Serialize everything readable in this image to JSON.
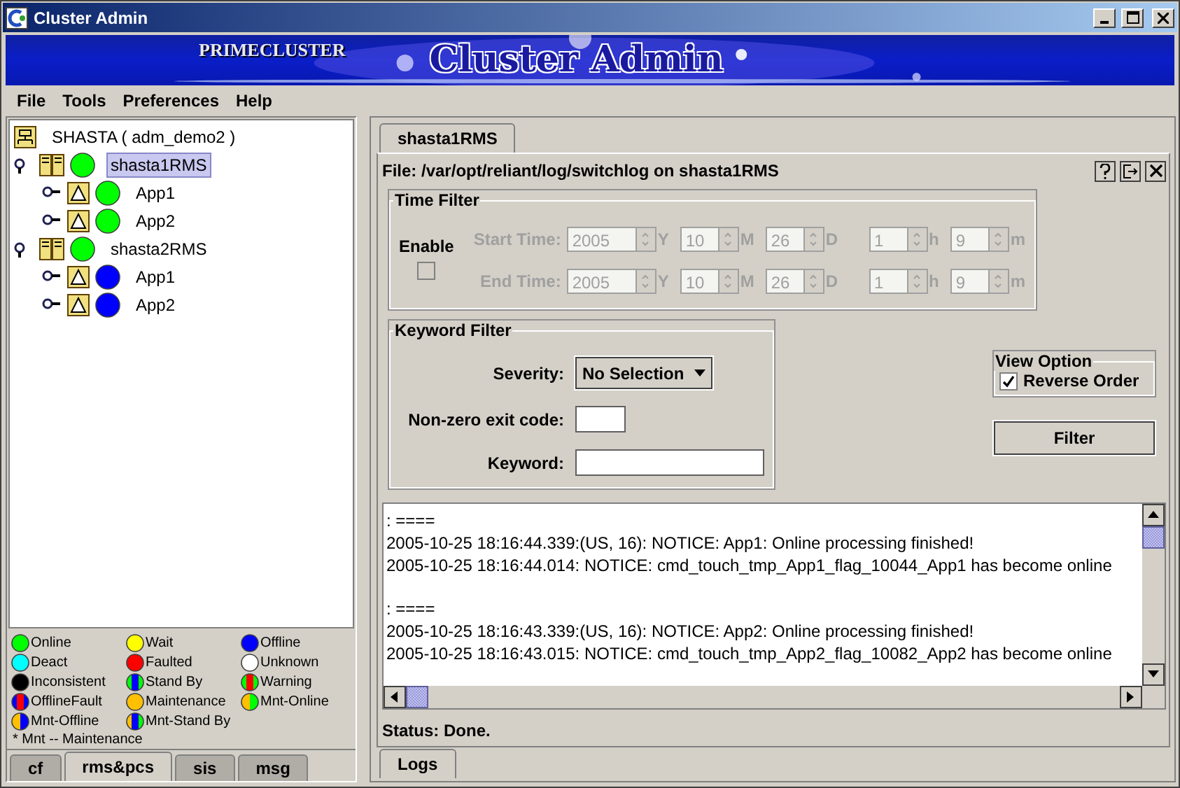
{
  "window": {
    "title": "Cluster Admin"
  },
  "banner": {
    "brand": "PRIMECLUSTER",
    "title": "Cluster Admin"
  },
  "menu": [
    "File",
    "Tools",
    "Preferences",
    "Help"
  ],
  "tree": {
    "label": "SHASTA ( adm_demo2 )",
    "kind": "cluster",
    "children": [
      {
        "label": "shasta1RMS",
        "kind": "node",
        "color": "#00ff00",
        "selected": true,
        "expanded": true,
        "children": [
          {
            "label": "App1",
            "kind": "app",
            "color": "#00ff00",
            "selected": false,
            "expanded": false
          },
          {
            "label": "App2",
            "kind": "app",
            "color": "#00ff00",
            "selected": false,
            "expanded": false
          }
        ]
      },
      {
        "label": "shasta2RMS",
        "kind": "node",
        "color": "#00ff00",
        "selected": false,
        "expanded": true,
        "children": [
          {
            "label": "App1",
            "kind": "app",
            "color": "#0000ff",
            "selected": false,
            "expanded": false
          },
          {
            "label": "App2",
            "kind": "app",
            "color": "#0000ff",
            "selected": false,
            "expanded": false
          }
        ]
      }
    ]
  },
  "legend": [
    {
      "label": "Online",
      "segments": [
        {
          "color": "#00ff00"
        }
      ]
    },
    {
      "label": "Wait",
      "segments": [
        {
          "color": "#ffff00"
        }
      ]
    },
    {
      "label": "Offline",
      "segments": [
        {
          "color": "#0000ff"
        }
      ]
    },
    {
      "label": "Deact",
      "segments": [
        {
          "color": "#00ffff"
        }
      ]
    },
    {
      "label": "Faulted",
      "segments": [
        {
          "color": "#ff0000"
        }
      ]
    },
    {
      "label": "Unknown",
      "segments": [
        {
          "color": "#ffffff"
        }
      ]
    },
    {
      "label": "Inconsistent",
      "segments": [
        {
          "color": "#000000"
        }
      ]
    },
    {
      "label": "Stand By",
      "segments": [
        {
          "color": "#00ff00"
        },
        {
          "color": "#0000ff"
        },
        {
          "color": "#00ff00"
        }
      ]
    },
    {
      "label": "Warning",
      "segments": [
        {
          "color": "#00ff00"
        },
        {
          "color": "#ff0000"
        },
        {
          "color": "#00ff00"
        }
      ]
    },
    {
      "label": "OfflineFault",
      "segments": [
        {
          "color": "#0000ff"
        },
        {
          "color": "#ff0000"
        },
        {
          "color": "#0000ff"
        }
      ]
    },
    {
      "label": "Maintenance",
      "segments": [
        {
          "color": "#ffc000"
        }
      ]
    },
    {
      "label": "Mnt-Online",
      "segments": [
        {
          "color": "#ffc000"
        },
        {
          "color": "#00ff00"
        }
      ]
    },
    {
      "label": "Mnt-Offline",
      "segments": [
        {
          "color": "#ffc000"
        },
        {
          "color": "#0000ff"
        }
      ]
    },
    {
      "label": "Mnt-Stand By",
      "segments": [
        {
          "color": "#ffc000"
        },
        {
          "color": "#0000ff"
        },
        {
          "color": "#00ff00"
        }
      ]
    }
  ],
  "legend_note": "* Mnt -- Maintenance",
  "left_tabs": [
    {
      "label": "cf",
      "selected": false
    },
    {
      "label": "rms&pcs",
      "selected": true
    },
    {
      "label": "sis",
      "selected": false
    },
    {
      "label": "msg",
      "selected": false
    }
  ],
  "right_tabs": [
    {
      "label": "shasta1RMS",
      "selected": true
    }
  ],
  "file_line": "File: /var/opt/reliant/log/switchlog on shasta1RMS",
  "time_filter": {
    "title": "Time Filter",
    "enable_label": "Enable",
    "enabled": false,
    "rows": [
      {
        "label": "Start Time:",
        "fields": [
          {
            "value": "2005",
            "unit": "Y"
          },
          {
            "value": "10",
            "unit": "M"
          },
          {
            "value": "26",
            "unit": "D"
          },
          {
            "value": "1",
            "unit": "h"
          },
          {
            "value": "9",
            "unit": "m"
          }
        ]
      },
      {
        "label": "End Time:",
        "fields": [
          {
            "value": "2005",
            "unit": "Y"
          },
          {
            "value": "10",
            "unit": "M"
          },
          {
            "value": "26",
            "unit": "D"
          },
          {
            "value": "1",
            "unit": "h"
          },
          {
            "value": "9",
            "unit": "m"
          }
        ]
      }
    ]
  },
  "keyword_filter": {
    "title": "Keyword Filter",
    "severity_label": "Severity:",
    "severity_value": "No Selection",
    "exit_code_label": "Non-zero exit code:",
    "keyword_label": "Keyword:"
  },
  "view_option": {
    "title": "View Option",
    "label": "Reverse Order",
    "checked": true
  },
  "filter_button": "Filter",
  "log_groups": [
    [
      ": ====",
      "2005-10-25 18:16:44.339:(US, 16): NOTICE: App1: Online processing finished!",
      "2005-10-25 18:16:44.014: NOTICE: cmd_touch_tmp_App1_flag_10044_App1 has become online"
    ],
    [
      ": ====",
      "2005-10-25 18:16:43.339:(US, 16): NOTICE: App2: Online processing finished!",
      "2005-10-25 18:16:43.015: NOTICE: cmd_touch_tmp_App2_flag_10082_App2 has become online"
    ]
  ],
  "status": "Status: Done.",
  "bottom_tabs": [
    {
      "label": "Logs",
      "selected": true
    }
  ]
}
